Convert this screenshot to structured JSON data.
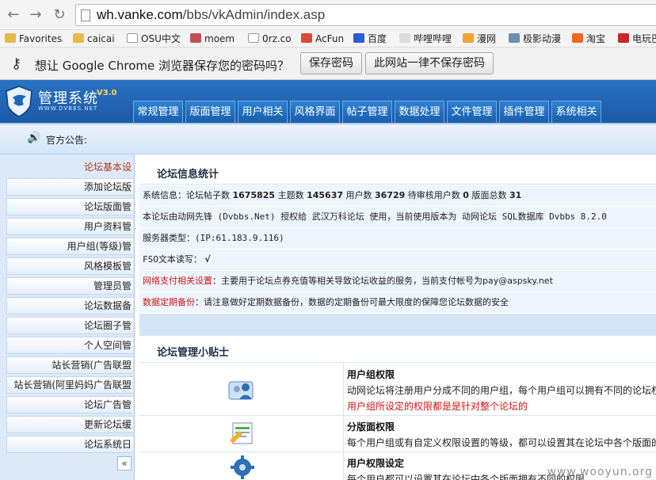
{
  "browser": {
    "url_host": "wh.vanke.com",
    "url_path": "/bbs/vkAdmin/index.asp",
    "bookmarks": [
      "Favorites",
      "caicai",
      "OSU中文",
      "moem",
      "0rz.co",
      "AcFun",
      "百度",
      "哔哩哔哩",
      "漫网",
      "极影动漫",
      "淘宝",
      "电玩巴"
    ],
    "infobar": {
      "message": "想让 Google Chrome 浏览器保存您的密码吗？",
      "save_btn": "保存密码",
      "never_btn": "此网站一律不保存密码"
    }
  },
  "header": {
    "title": "管理系统",
    "version": "V3.0",
    "subtitle": "WWW.DVBBS.NET",
    "tabs": [
      "常规管理",
      "版面管理",
      "用户相关",
      "风格界面",
      "帖子管理",
      "数据处理",
      "文件管理",
      "插件管理",
      "系统相关"
    ]
  },
  "notice": {
    "label": "官方公告:"
  },
  "sidebar": {
    "items": [
      "论坛基本设",
      "添加论坛版",
      "论坛版面管",
      "用户资料管",
      "用户组(等级)管",
      "风格模板管",
      "管理员管",
      "论坛数据备",
      "论坛圈子管",
      "个人空间管",
      "站长营销(广告联盟",
      "站长营销(阿里妈妈广告联盟",
      "论坛广告管",
      "更新论坛缓",
      "论坛系统日"
    ],
    "collapse": "«"
  },
  "stats": {
    "title": "论坛信息统计",
    "sys_label": "系统信息：论坛帖子数",
    "posts": "1675825",
    "topics_label": "主题数",
    "topics": "145637",
    "users_label": "用户数",
    "users": "36729",
    "pending_label": "待审核用户数",
    "pending": "0",
    "boards_label": "版面总数",
    "boards": "31",
    "license": "本论坛由动网先锋 (Dvbbs.Net) 授权给 武汉万科论坛 使用，当前使用版本为 动网论坛 SQL数据库 Dvbbs 8.2.0",
    "server": "服务器类型：(IP:61.183.9.116)",
    "fso": "FSO文本读写：",
    "fso_mark": "√",
    "pay_label": "网络支付相关设置",
    "pay_text": "：主要用于论坛点券充值等相关导致论坛收益的服务，当前支付帐号为pay@aspsky.net",
    "backup_label": "数据定期备份",
    "backup_text": "：请注意做好定期数据备份，数据的定期备份可最大限度的保障您论坛数据的安全"
  },
  "tips": {
    "title": "论坛管理小贴士",
    "items": [
      {
        "title": "用户组权限",
        "desc": "动网论坛将注册用户分成不同的用户组，每个用户组可以拥有不同的论坛权",
        "desc_red": "用户组所设定的权限都是是针对整个论坛的"
      },
      {
        "title": "分版面权限",
        "desc": "每个用户组或有自定义权限设置的等级，都可以设置其在论坛中各个版面的"
      },
      {
        "title": "用户权限设定",
        "desc": "每个用户都可以设置其在论坛中各个版面拥有不同的权限"
      }
    ]
  },
  "watermark": "www.wooyun.org",
  "colors": {
    "header_blue": "#1f63b0",
    "sidebar_bg": "#dbe9f8",
    "alert_red": "#d21414",
    "active_item": "#b5341a"
  }
}
